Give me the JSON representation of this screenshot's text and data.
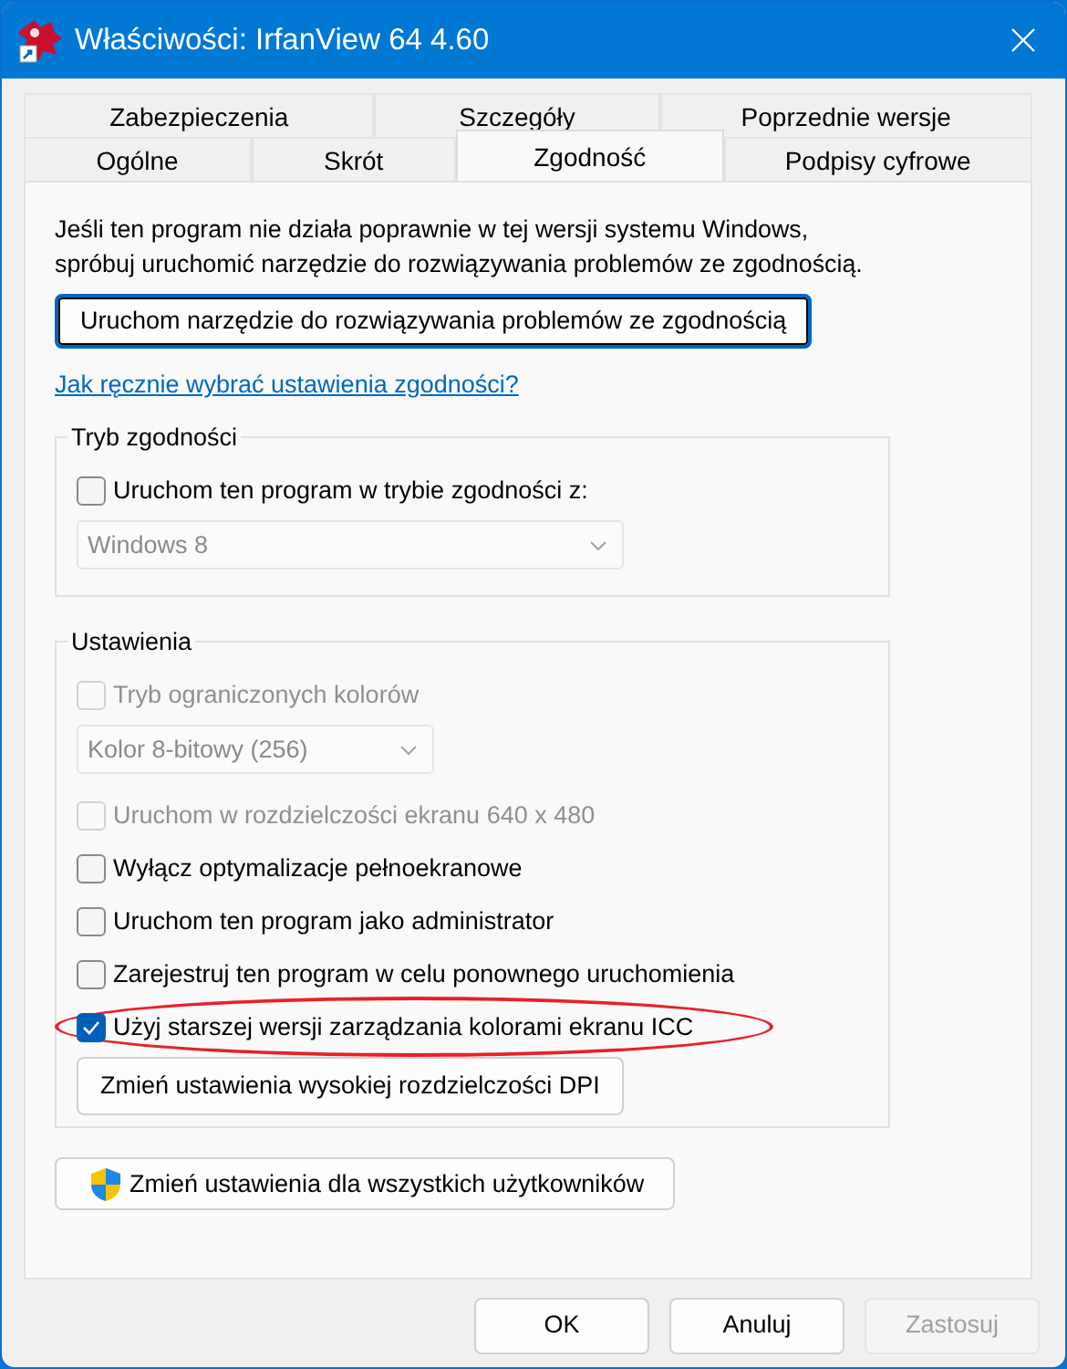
{
  "window": {
    "title": "Właściwości: IrfanView 64 4.60"
  },
  "tab_rows": [
    [
      {
        "label": "Zabezpieczenia",
        "selected": false
      },
      {
        "label": "Szczegóły",
        "selected": false
      },
      {
        "label": "Poprzednie wersje",
        "selected": false
      }
    ],
    [
      {
        "label": "Ogólne",
        "selected": false
      },
      {
        "label": "Skrót",
        "selected": false
      },
      {
        "label": "Zgodność",
        "selected": true
      },
      {
        "label": "Podpisy cyfrowe",
        "selected": false
      }
    ]
  ],
  "intro": "Jeśli ten program nie działa poprawnie w tej wersji systemu Windows, spróbuj uruchomić narzędzie do rozwiązywania problemów ze zgodnością.",
  "troubleshoot_button": "Uruchom narzędzie do rozwiązywania problemów ze zgodnością",
  "help_link": "Jak ręcznie wybrać ustawienia zgodności?",
  "groups": [
    {
      "title": "Tryb zgodności",
      "items": [
        {
          "kind": "checkbox",
          "label": "Uruchom ten program w trybie zgodności z:",
          "checked": false,
          "disabled": false,
          "highlighted": false
        },
        {
          "kind": "select",
          "value": "Windows 8",
          "disabled": true
        }
      ]
    },
    {
      "title": "Ustawienia",
      "items": [
        {
          "kind": "checkbox",
          "label": "Tryb ograniczonych kolorów",
          "checked": false,
          "disabled": true,
          "highlighted": false
        },
        {
          "kind": "select",
          "value": "Kolor 8-bitowy (256)",
          "disabled": true
        },
        {
          "kind": "checkbox",
          "label": "Uruchom w rozdzielczości ekranu 640 x 480",
          "checked": false,
          "disabled": true,
          "highlighted": false
        },
        {
          "kind": "checkbox",
          "label": "Wyłącz optymalizacje pełnoekranowe",
          "checked": false,
          "disabled": false,
          "highlighted": false
        },
        {
          "kind": "checkbox",
          "label": "Uruchom ten program jako administrator",
          "checked": false,
          "disabled": false,
          "highlighted": false
        },
        {
          "kind": "checkbox",
          "label": "Zarejestruj ten program w celu ponownego uruchomienia",
          "checked": false,
          "disabled": false,
          "highlighted": false
        },
        {
          "kind": "checkbox",
          "label": "Użyj starszej wersji zarządzania kolorami ekranu ICC",
          "checked": true,
          "disabled": false,
          "highlighted": true
        },
        {
          "kind": "button",
          "label": "Zmień ustawienia wysokiej rozdzielczości DPI"
        }
      ]
    }
  ],
  "all_users_button": "Zmień ustawienia dla wszystkich użytkowników",
  "footer_buttons": [
    {
      "label": "OK",
      "disabled": false
    },
    {
      "label": "Anuluj",
      "disabled": false
    },
    {
      "label": "Zastosuj",
      "disabled": true
    }
  ]
}
